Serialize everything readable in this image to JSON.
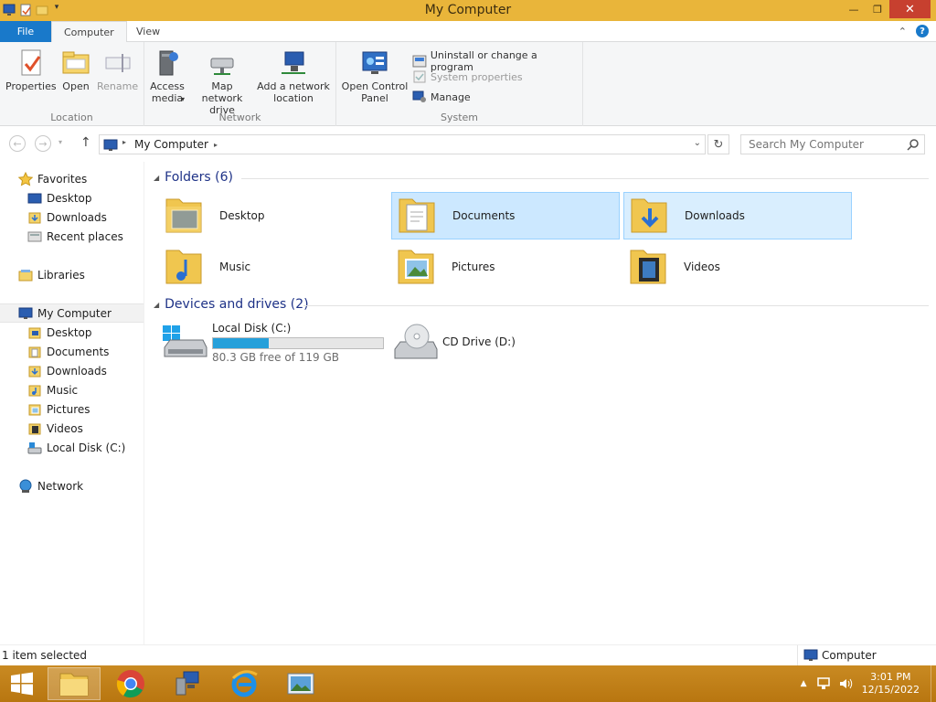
{
  "window": {
    "title": "My Computer"
  },
  "ribbon_tabs": {
    "file": "File",
    "computer": "Computer",
    "view": "View"
  },
  "ribbon": {
    "location": {
      "label": "Location",
      "properties": "Properties",
      "open": "Open",
      "rename": "Rename"
    },
    "network": {
      "label": "Network",
      "access_media": "Access media",
      "map_network_drive": "Map network drive",
      "add_network_location": "Add a network location"
    },
    "system": {
      "label": "System",
      "open_control_panel": "Open Control Panel",
      "uninstall": "Uninstall or change a program",
      "system_properties": "System properties",
      "manage": "Manage"
    }
  },
  "address": {
    "path": "My Computer",
    "search_placeholder": "Search My Computer"
  },
  "nav": {
    "favorites": "Favorites",
    "fav_desktop": "Desktop",
    "fav_downloads": "Downloads",
    "fav_recent": "Recent places",
    "libraries": "Libraries",
    "my_computer": "My Computer",
    "pc_desktop": "Desktop",
    "pc_documents": "Documents",
    "pc_downloads": "Downloads",
    "pc_music": "Music",
    "pc_pictures": "Pictures",
    "pc_videos": "Videos",
    "pc_local_disk": "Local Disk (C:)",
    "network": "Network"
  },
  "content": {
    "folders_header": "Folders (6)",
    "folders": {
      "desktop": "Desktop",
      "documents": "Documents",
      "downloads": "Downloads",
      "music": "Music",
      "pictures": "Pictures",
      "videos": "Videos"
    },
    "devices_header": "Devices and drives (2)",
    "drives": {
      "local_disk_name": "Local Disk (C:)",
      "local_disk_free": "80.3 GB free of 119 GB",
      "local_disk_used_fraction": 0.33,
      "cd_name": "CD Drive (D:)"
    }
  },
  "status": {
    "left": "1 item selected",
    "right": "Computer"
  },
  "taskbar": {
    "time": "3:01 PM",
    "date": "12/15/2022"
  },
  "colors": {
    "titlebar": "#e9b53a",
    "file_tab": "#1979ca",
    "selection": "#cce8ff",
    "progress": "#26a0da",
    "taskbar": "#c98a22"
  }
}
